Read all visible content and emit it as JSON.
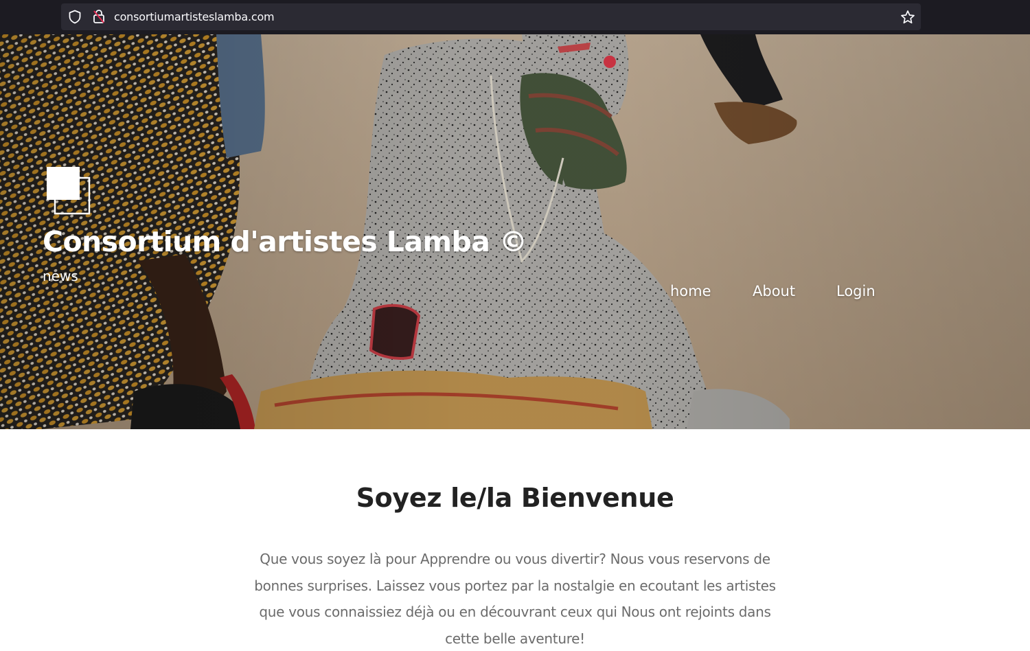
{
  "browser": {
    "url": "consortiumartisteslamba.com",
    "icons": [
      "shield-icon",
      "lock-icon",
      "star-icon"
    ]
  },
  "header": {
    "site_title": "Consortium d'artistes Lamba ©",
    "tagline": "news",
    "logo_icon": "overlapping-squares-icon"
  },
  "nav": {
    "items": [
      {
        "label": "home"
      },
      {
        "label": "About"
      },
      {
        "label": "Login"
      }
    ]
  },
  "main": {
    "title": "Soyez le/la Bienvenue",
    "text": "Que vous soyez là pour Apprendre ou vous divertir? Nous vous reservons de bonnes surprises. Laissez vous portez par la nostalgie en ecoutant les artistes que vous connaissiez déjà ou en découvrant ceux qui Nous ont rejoints dans cette belle aventure!"
  },
  "colors": {
    "browser_bg": "#1c1b22",
    "url_bg": "#2b2a33",
    "title_text": "#222222",
    "body_text": "#6b6b6b"
  }
}
